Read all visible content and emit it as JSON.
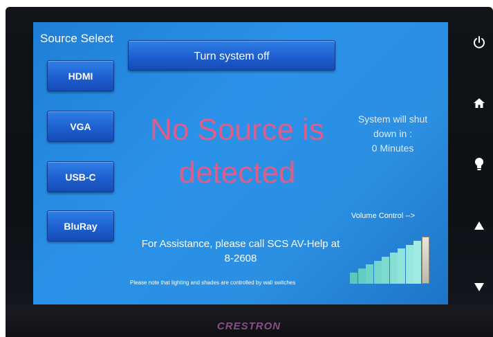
{
  "source_select": {
    "title": "Source Select",
    "items": [
      {
        "label": "HDMI"
      },
      {
        "label": "VGA"
      },
      {
        "label": "USB-C"
      },
      {
        "label": "BluRay"
      }
    ]
  },
  "system": {
    "turn_off_label": "Turn system off",
    "shutdown_line1": "System will shut",
    "shutdown_line2": "down in :",
    "shutdown_line3": "0 Minutes"
  },
  "status": {
    "line1": "No Source is",
    "line2": "detected"
  },
  "assistance": {
    "line1": "For Assistance, please call SCS AV-Help at",
    "line2": "8-2608",
    "note": "Please note that lighting and shades are controlled by wall switches"
  },
  "volume": {
    "label": "Volume Control -->",
    "level": 1.0,
    "bar_count": 10
  },
  "side_controls": [
    {
      "icon": "power-icon"
    },
    {
      "icon": "home-icon"
    },
    {
      "icon": "light-bulb-icon"
    },
    {
      "icon": "arrow-up-icon"
    },
    {
      "icon": "arrow-down-icon"
    }
  ],
  "brand": "CRESTRON",
  "colors": {
    "screen": "#2a92e8",
    "alert_text": "#e05d8a",
    "button": "#1e5fd0"
  }
}
